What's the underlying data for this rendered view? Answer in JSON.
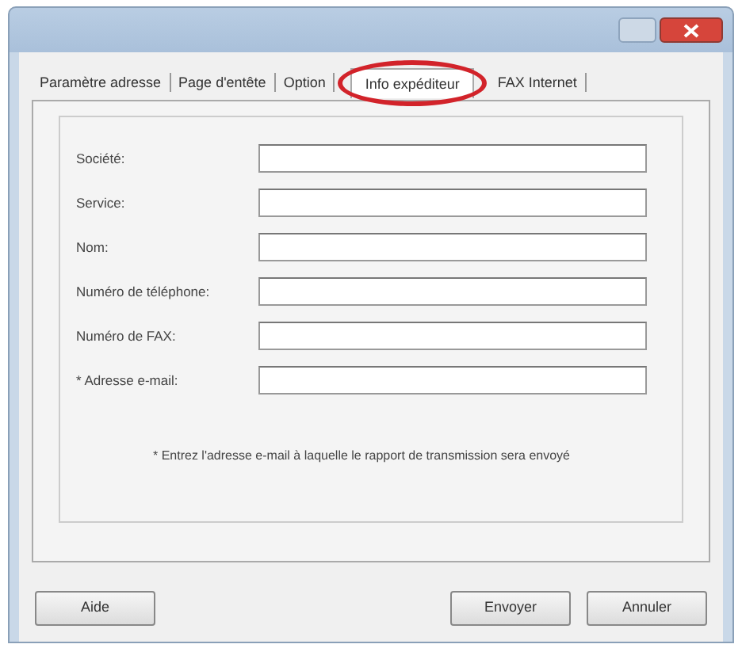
{
  "tabs": [
    {
      "label": "Paramètre adresse",
      "selected": false
    },
    {
      "label": "Page d'entête",
      "selected": false
    },
    {
      "label": "Option",
      "selected": false
    },
    {
      "label": "Info expéditeur",
      "selected": true,
      "highlighted": true
    },
    {
      "label": "FAX Internet",
      "selected": false
    }
  ],
  "fields": [
    {
      "label": "Société:"
    },
    {
      "label": "Service:"
    },
    {
      "label": "Nom:"
    },
    {
      "label": "Numéro de téléphone:"
    },
    {
      "label": "Numéro de FAX:"
    },
    {
      "label": "* Adresse e-mail:"
    }
  ],
  "note": "* Entrez l'adresse e-mail à laquelle le rapport de transmission sera envoyé",
  "buttons": [
    {
      "label": "Aide",
      "kind": "left"
    },
    {
      "label": "Envoyer",
      "kind": "right"
    },
    {
      "label": "Annuler",
      "kind": "right"
    }
  ]
}
